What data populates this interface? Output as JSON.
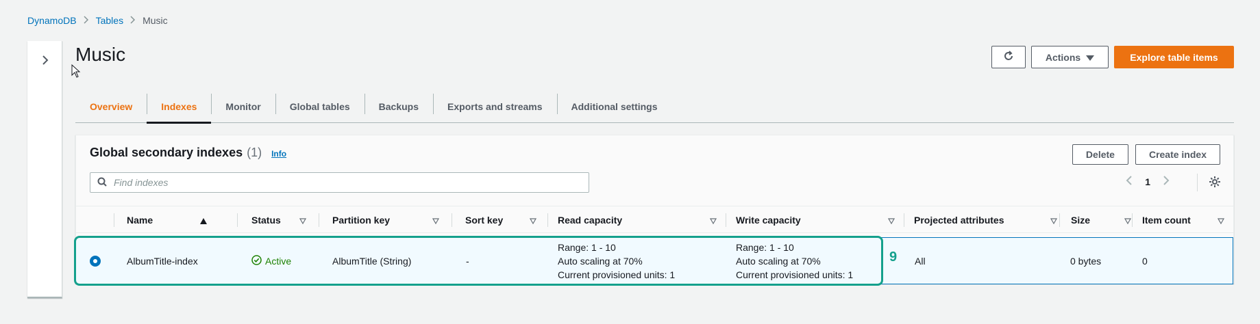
{
  "breadcrumb": {
    "items": [
      "DynamoDB",
      "Tables"
    ],
    "current": "Music"
  },
  "page": {
    "title": "Music"
  },
  "header_actions": {
    "actions_label": "Actions",
    "explore_label": "Explore table items"
  },
  "tabs": [
    {
      "label": "Overview"
    },
    {
      "label": "Indexes"
    },
    {
      "label": "Monitor"
    },
    {
      "label": "Global tables"
    },
    {
      "label": "Backups"
    },
    {
      "label": "Exports and streams"
    },
    {
      "label": "Additional settings"
    }
  ],
  "active_tab": "Indexes",
  "panel": {
    "title": "Global secondary indexes",
    "count": "(1)",
    "info": "Info",
    "delete_label": "Delete",
    "create_label": "Create index",
    "search_placeholder": "Find indexes",
    "page_number": "1"
  },
  "table": {
    "columns": [
      {
        "label": "Name",
        "sort": "ascending"
      },
      {
        "label": "Status"
      },
      {
        "label": "Partition key"
      },
      {
        "label": "Sort key"
      },
      {
        "label": "Read capacity"
      },
      {
        "label": "Write capacity"
      },
      {
        "label": "Projected attributes"
      },
      {
        "label": "Size"
      },
      {
        "label": "Item count"
      }
    ],
    "rows": [
      {
        "selected": true,
        "name": "AlbumTitle-index",
        "status": "Active",
        "partition_key": "AlbumTitle (String)",
        "sort_key": "-",
        "read_capacity": {
          "line1": "Range: 1 - 10",
          "line2": "Auto scaling at 70%",
          "line3": "Current provisioned units: 1"
        },
        "write_capacity": {
          "line1": "Range: 1 - 10",
          "line2": "Auto scaling at 70%",
          "line3": "Current provisioned units: 1"
        },
        "projected_attributes": "All",
        "size": "0 bytes",
        "item_count": "0"
      }
    ]
  },
  "annotation": {
    "label": "9",
    "color": "#14a08c"
  },
  "colors": {
    "accent": "#ec7211",
    "link": "#0073bb",
    "success": "#1d8102"
  }
}
